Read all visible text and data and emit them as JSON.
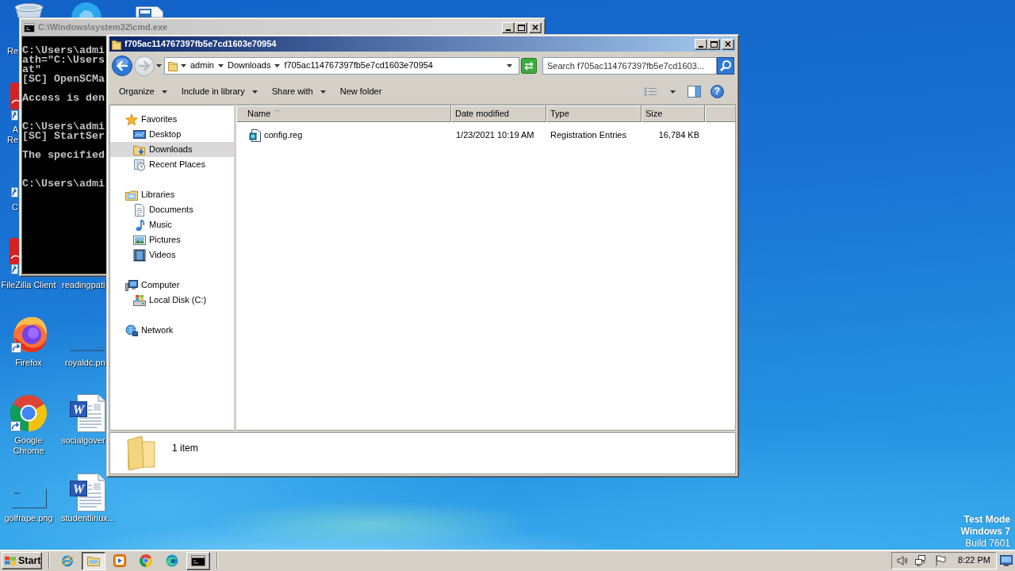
{
  "desktop_icons": [
    {
      "label": "Re"
    },
    {
      "label": "A Re",
      "shortcut": true
    },
    {
      "label": "C",
      "shortcut": true
    },
    {
      "label": "FileZilla Client",
      "shortcut": true
    },
    {
      "label": "Firefox",
      "shortcut": true
    },
    {
      "label": "Google Chrome",
      "shortcut": true
    },
    {
      "label": "golfrape.png",
      "shortcut": false
    },
    {
      "label": "readingpati"
    },
    {
      "label": "royaldc.pn",
      "shortcut": false
    },
    {
      "label": "socialgover",
      "shortcut": false,
      "icon_letter": "W"
    },
    {
      "label": "studentlinux...",
      "shortcut": false,
      "icon_letter": "W"
    }
  ],
  "console_window": {
    "title": "C:\\Windows\\system32\\cmd.exe",
    "active": false,
    "output": "C:\\Users\\admi\nath=\"C:\\Users\nat\"\n[SC] OpenSCMa\n\nAccess is den\n\n\nC:\\Users\\admi\n[SC] StartSer\n\nThe specified\n\n\nC:\\Users\\admi"
  },
  "explorer_window": {
    "title": "f705ac114767397fb5e7cd1603e70954",
    "active": true,
    "back_enabled": true,
    "forward_enabled": false,
    "breadcrumbs": [
      "admin",
      "Downloads",
      "f705ac114767397fb5e7cd1603e70954"
    ],
    "search": {
      "placeholder": "Search f705ac114767397fb5e7cd1603..."
    },
    "command_bar": [
      {
        "label": "Organize",
        "menu": true
      },
      {
        "label": "Include in library",
        "menu": true
      },
      {
        "label": "Share with",
        "menu": true
      },
      {
        "label": "New folder",
        "menu": false
      }
    ],
    "help_label": "?",
    "navigation_pane": [
      {
        "label": "Favorites",
        "selected": false,
        "children": [
          {
            "label": "Desktop",
            "selected": false
          },
          {
            "label": "Downloads",
            "selected": true
          },
          {
            "label": "Recent Places",
            "selected": false
          }
        ]
      },
      {
        "label": "Libraries",
        "selected": false,
        "children": [
          {
            "label": "Documents",
            "selected": false
          },
          {
            "label": "Music",
            "selected": false
          },
          {
            "label": "Pictures",
            "selected": false
          },
          {
            "label": "Videos",
            "selected": false
          }
        ]
      },
      {
        "label": "Computer",
        "selected": false,
        "children": [
          {
            "label": "Local Disk (C:)",
            "selected": false
          }
        ]
      },
      {
        "label": "Network",
        "selected": false
      }
    ],
    "columns": [
      {
        "label": "Name",
        "sorted": true
      },
      {
        "label": "Date modified",
        "sorted": false
      },
      {
        "label": "Type",
        "sorted": false
      },
      {
        "label": "Size",
        "sorted": false
      }
    ],
    "files": [
      {
        "name": "config.reg",
        "date_modified": "1/23/2021 10:19 AM",
        "type": "Registration Entries",
        "size": "16,784 KB",
        "selected": false
      }
    ],
    "details": "1 item"
  },
  "taskbar": {
    "start_label": "Start",
    "buttons": [
      {
        "running": false,
        "selected": false
      },
      {
        "running": true,
        "selected": true
      },
      {
        "running": false,
        "selected": false
      },
      {
        "running": false,
        "selected": false
      },
      {
        "running": false,
        "selected": false
      },
      {
        "running": true,
        "selected": false
      }
    ],
    "clock": "8:22 PM"
  },
  "system_notice": [
    "Test Mode",
    "Windows 7",
    "Build 7601"
  ]
}
